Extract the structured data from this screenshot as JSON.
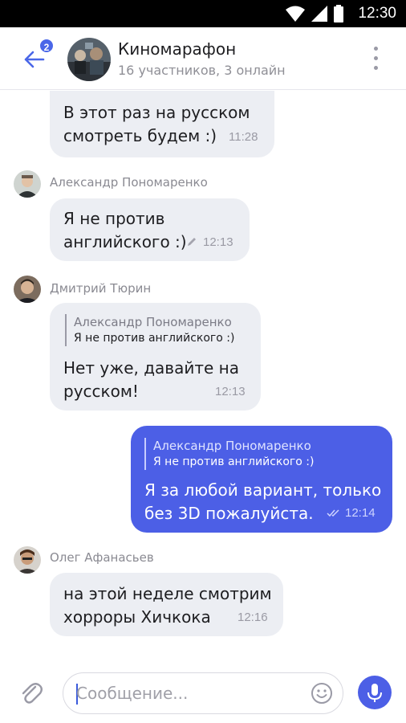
{
  "status_bar": {
    "time": "12:30"
  },
  "header": {
    "back_badge": "2",
    "title": "Киномарафон",
    "subtitle": "16 участников, 3 онлайн"
  },
  "messages": [
    {
      "id": 1,
      "direction": "in",
      "text_lines": [
        "В этот раз на русском",
        "смотреть будем :)"
      ],
      "time": "11:28"
    },
    {
      "id": 2,
      "direction": "in",
      "sender": "Александр Пономаренко",
      "text_lines": [
        "Я не против",
        "английского :)"
      ],
      "time": "12:13",
      "edited": true
    },
    {
      "id": 3,
      "direction": "in",
      "sender": "Дмитрий Тюрин",
      "quote": {
        "name": "Александр Пономаренко",
        "text": "Я не против английского :)"
      },
      "text_lines": [
        "Нет уже, давайте на",
        "русском!"
      ],
      "time": "12:13"
    },
    {
      "id": 4,
      "direction": "out",
      "quote": {
        "name": "Александр Пономаренко",
        "text": "Я не против английского :)"
      },
      "text_lines": [
        "Я за любой вариант, только",
        "без 3D пожалуйста."
      ],
      "time": "12:14",
      "read": true
    },
    {
      "id": 5,
      "direction": "in",
      "sender": "Олег Афанасьев",
      "text_lines": [
        "на этой неделе смотрим",
        "хорроры Хичкока"
      ],
      "time": "12:16"
    }
  ],
  "composer": {
    "placeholder": "Сообщение..."
  },
  "colors": {
    "accent": "#4c5fe6",
    "incoming_bubble": "#eceef3",
    "badge": "#4a67e8"
  },
  "icons": [
    "back-arrow-icon",
    "more-vert-icon",
    "pencil-icon",
    "double-check-icon",
    "paperclip-icon",
    "smile-icon",
    "microphone-icon",
    "wifi-icon",
    "signal-icon",
    "battery-icon"
  ]
}
